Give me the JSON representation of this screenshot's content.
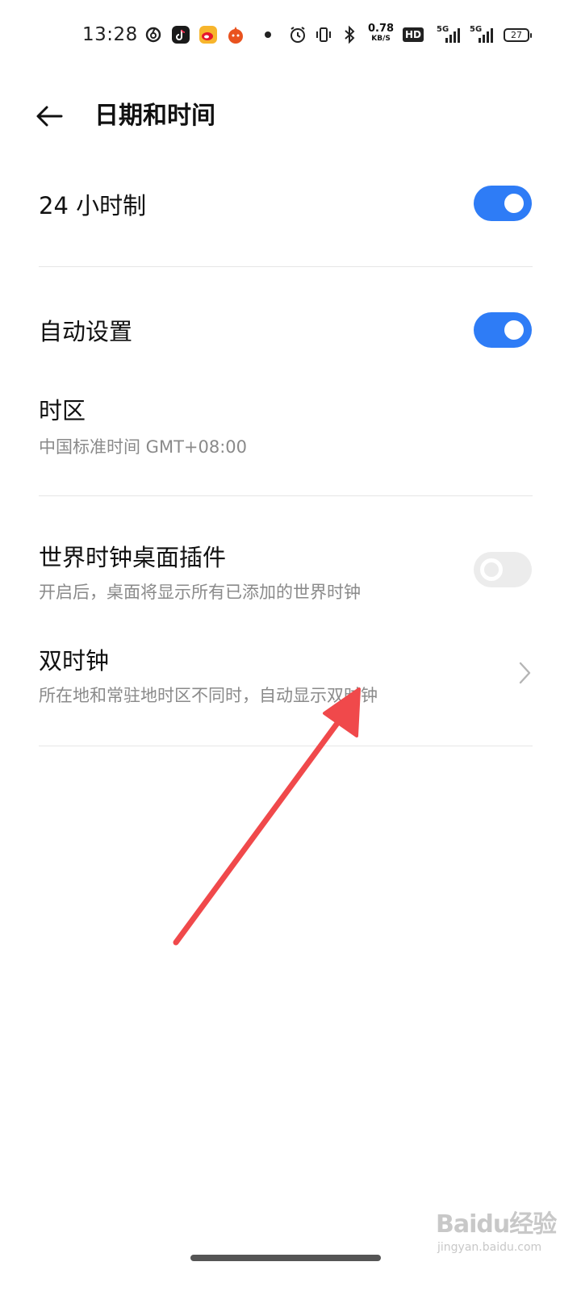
{
  "status_bar": {
    "time": "13:28",
    "net_speed_value": "0.78",
    "net_speed_unit": "KB/S",
    "hd_label": "HD",
    "signal1_label": "5G",
    "signal2_label": "5G",
    "battery_level": "27"
  },
  "header": {
    "title": "日期和时间"
  },
  "settings": {
    "hour24": {
      "label": "24 小时制",
      "enabled": true
    },
    "auto_set": {
      "label": "自动设置",
      "enabled": true
    },
    "timezone": {
      "label": "时区",
      "value": "中国标准时间 GMT+08:00"
    },
    "world_clock_widget": {
      "label": "世界时钟桌面插件",
      "description": "开启后，桌面将显示所有已添加的世界时钟",
      "enabled": false
    },
    "dual_clock": {
      "label": "双时钟",
      "description": "所在地和常驻地时区不同时，自动显示双时钟"
    }
  },
  "annotation": {
    "color": "#f0494b"
  },
  "watermark": {
    "logo": "Baidu经验",
    "url": "jingyan.baidu.com"
  },
  "colors": {
    "accent": "#2e7cf6",
    "toggle_off": "#ececec",
    "secondary_text": "#8a8a8a"
  }
}
